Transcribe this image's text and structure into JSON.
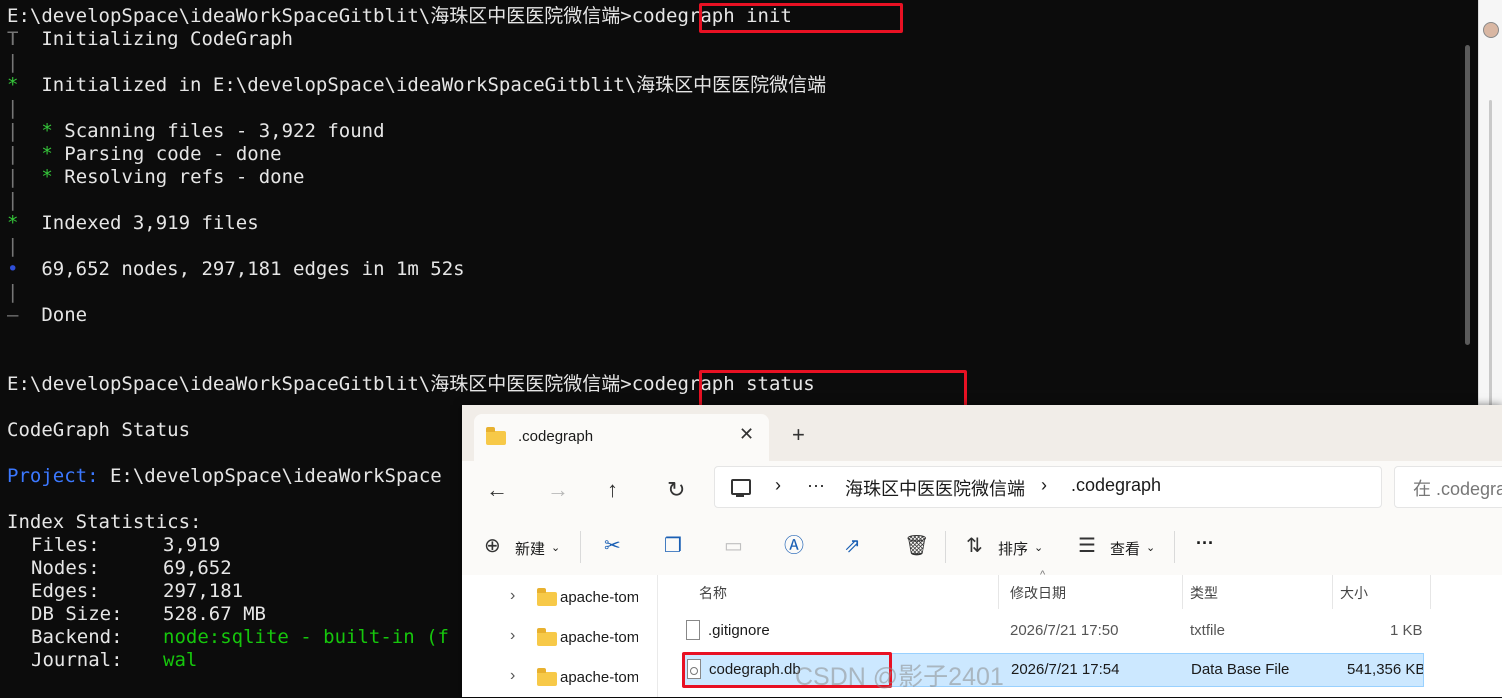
{
  "terminal": {
    "prompt1": "E:\\developSpace\\ideaWorkSpaceGitblit\\海珠区中医医院微信端>",
    "cmd1": "codegraph init",
    "line_init": "Initializing CodeGraph",
    "line_initialized": "Initialized in E:\\developSpace\\ideaWorkSpaceGitblit\\海珠区中医医院微信端",
    "line_scan": "Scanning files - 3,922 found",
    "line_parse": "Parsing code - done",
    "line_resolve": "Resolving refs - done",
    "line_indexed": "Indexed 3,919 files",
    "line_nodes": "69,652 nodes, 297,181 edges in 1m 52s",
    "line_done": "Done",
    "prompt2": "E:\\developSpace\\ideaWorkSpaceGitblit\\海珠区中医医院微信端>",
    "cmd2": "codegraph status",
    "status_title": "CodeGraph Status",
    "project_label": "Project:",
    "project_value": "E:\\developSpace\\ideaWorkSpace",
    "stats_title": "Index Statistics:",
    "stats": [
      {
        "label": "Files:",
        "value": "3,919"
      },
      {
        "label": "Nodes:",
        "value": "69,652"
      },
      {
        "label": "Edges:",
        "value": "297,181"
      },
      {
        "label": "DB Size:",
        "value": "528.67 MB"
      },
      {
        "label": "Backend:",
        "value": "node:sqlite - built-in (f"
      },
      {
        "label": "Journal:",
        "value": "wal"
      }
    ],
    "gutter": {
      "T": "T",
      "bar": "|",
      "star": "*",
      "dot": "•",
      "dash": "—"
    },
    "colors": {
      "highlight": "#e81123",
      "green": "#35c63a",
      "blue_label": "#3b78ff"
    }
  },
  "explorer": {
    "tab_title": ".codegraph",
    "tab_close": "✕",
    "new_tab": "+",
    "nav": {
      "back": "←",
      "forward": "→",
      "up": "↑",
      "refresh": "↻"
    },
    "breadcrumb": {
      "sep": "›",
      "more": "···",
      "folder": "海珠区中医医院微信端",
      "current": ".codegraph"
    },
    "search_placeholder": "在 .codegra",
    "toolbar": {
      "new_label": "新建",
      "sort_label": "排序",
      "view_label": "查看",
      "more": "···"
    },
    "nav_tree": [
      {
        "label": "apache-tomcat"
      },
      {
        "label": "apache-tomcat"
      },
      {
        "label": "apache-tomcat"
      }
    ],
    "columns": {
      "name": "名称",
      "date": "修改日期",
      "type": "类型",
      "size": "大小"
    },
    "files": [
      {
        "name": ".gitignore",
        "date": "2026/7/21 17:50",
        "type": "txtfile",
        "size": "1 KB"
      },
      {
        "name": "codegraph.db",
        "date": "2026/7/21 17:54",
        "type": "Data Base File",
        "size": "541,356 KB"
      }
    ]
  },
  "watermark": "CSDN @影子2401"
}
